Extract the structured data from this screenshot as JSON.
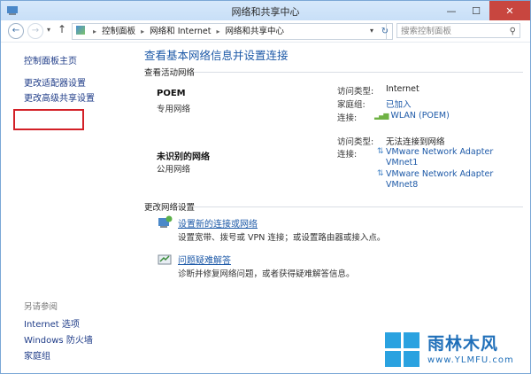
{
  "window": {
    "title": "网络和共享中心"
  },
  "titlebar_buttons": {
    "min": "—",
    "max": "☐",
    "close": "✕"
  },
  "nav": {
    "back": "←",
    "forward": "→",
    "dropdown": "▾",
    "up": "↑",
    "refresh": "↻"
  },
  "address": {
    "crumbs": [
      "控制面板",
      "网络和 Internet",
      "网络和共享中心"
    ],
    "separator": "▸"
  },
  "search": {
    "placeholder": "搜索控制面板",
    "icon": "search-icon"
  },
  "sidebar": {
    "items": [
      {
        "label": "控制面板主页"
      },
      {
        "label": "更改适配器设置"
      },
      {
        "label": "更改高级共享设置"
      }
    ],
    "see_also_title": "另请参阅",
    "see_also": [
      {
        "label": "Internet 选项"
      },
      {
        "label": "Windows 防火墙"
      },
      {
        "label": "家庭组"
      }
    ]
  },
  "main": {
    "title": "查看基本网络信息并设置连接",
    "active_networks_heading": "查看活动网络",
    "networks": [
      {
        "name": "POEM",
        "type": "专用网络",
        "access_label": "访问类型:",
        "access_value": "Internet",
        "homegroup_label": "家庭组:",
        "homegroup_value": "已加入",
        "connection_label": "连接:",
        "connection_value": "WLAN (POEM)"
      },
      {
        "name": "未识别的网络",
        "type": "公用网络",
        "access_label": "访问类型:",
        "access_value": "无法连接到网络",
        "connection_label": "连接:",
        "connections": [
          "VMware Network Adapter VMnet1",
          "VMware Network Adapter VMnet8"
        ],
        "conn_lines": [
          "VMware Network Adapter",
          "VMnet1",
          "VMware Network Adapter",
          "VMnet8"
        ]
      }
    ],
    "change_heading": "更改网络设置",
    "settings": [
      {
        "label": "设置新的连接或网络",
        "desc": "设置宽带、拨号或 VPN 连接；或设置路由器或接入点。"
      },
      {
        "label": "问题疑难解答",
        "desc": "诊断并修复网络问题，或者获得疑难解答信息。"
      }
    ]
  },
  "watermark": {
    "brand": "雨林木风",
    "url": "www.YLMFU.com"
  },
  "colors": {
    "link": "#1e5aa8",
    "highlight": "#d32027",
    "close": "#c8463f"
  }
}
